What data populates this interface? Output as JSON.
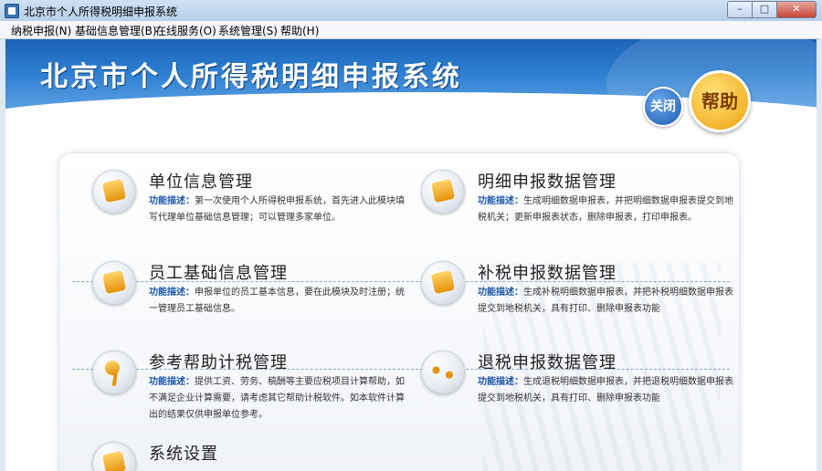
{
  "window": {
    "title": "北京市个人所得税明细申报系统"
  },
  "menu": [
    "纳税申报(N)",
    "基础信息管理(B)",
    "在线服务(O)",
    "系统管理(S)",
    "帮助(H)"
  ],
  "banner": {
    "title": "北京市个人所得税明细申报系统",
    "close_label": "关闭",
    "help_label": "帮助"
  },
  "desc_label": "功能描述：",
  "modules": [
    {
      "title": "单位信息管理",
      "desc": "第一次使用个人所得税申报系统，首先进入此模块填写代理单位基础信息管理；可以管理多家单位。"
    },
    {
      "title": "明细申报数据管理",
      "desc": "生成明细数据申报表，并把明细数据申报表提交到地税机关；更新申报表状态，删除申报表，打印申报表。"
    },
    {
      "title": "员工基础信息管理",
      "desc": "申报单位的员工基本信息，要在此模块及时注册；统一管理员工基础信息。"
    },
    {
      "title": "补税申报数据管理",
      "desc": "生成补税明细数据申报表，并把补税明细数据申报表提交到地税机关，具有打印、删除申报表功能"
    },
    {
      "title": "参考帮助计税管理",
      "desc": "提供工资、劳务、稿酬等主要应税项目计算帮助，如不满足企业计算需要，请考虑其它帮助计税软件。如本软件计算出的结果仅供申报单位参考。"
    },
    {
      "title": "退税申报数据管理",
      "desc": "生成退税明细数据申报表，并把退税明细数据申报表提交到地税机关，具有打印、删除申报表功能"
    },
    {
      "title": "系统设置",
      "desc": ""
    }
  ]
}
